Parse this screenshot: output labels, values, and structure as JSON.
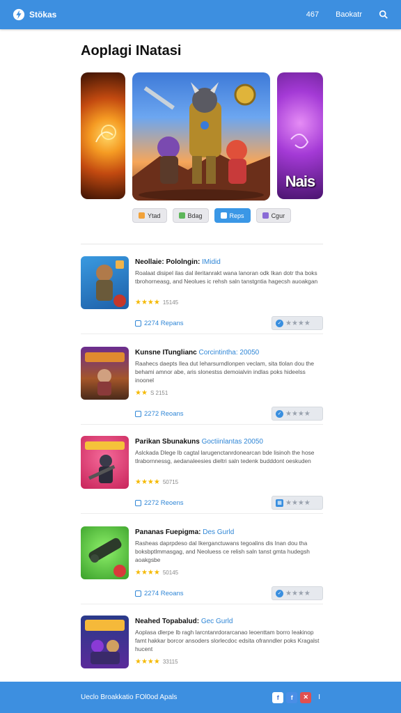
{
  "header": {
    "brand": "Stökas",
    "count": "467",
    "link": "Baokatr",
    "search_icon": "search-icon",
    "logo_icon": "lightning-logo-icon"
  },
  "page": {
    "title": "Aoplagi INatasi"
  },
  "carousel": {
    "right_slide_text": "Nais"
  },
  "tabs": [
    {
      "label": "Ytad",
      "icon_color": "#f2a23a",
      "active": false
    },
    {
      "label": "Bdag",
      "icon_color": "#5db65a",
      "active": false
    },
    {
      "label": "Reps",
      "icon_color": "#ffffff",
      "active": true
    },
    {
      "label": "Cgur",
      "icon_color": "#8a6bd6",
      "active": false
    }
  ],
  "apps": [
    {
      "title": "Neollaie: Pololngin:",
      "title_accent": "IMidid",
      "desc": "Roalaat disipel ilas dal ileritanrakt wana lanoran odk Ikan dotr tha boks tbrohorneasg, and Neolues ic rehsh saln tanstgntia hagecsh auoakgan",
      "stars": "★★★★",
      "rating_count": "15145",
      "reviews": "2274 Repans",
      "thumb_colors": [
        "#3a9ae0",
        "#f0b34a",
        "#c5362a"
      ]
    },
    {
      "title": "Kunsne ITunglianc",
      "title_accent": "Corcintintha: 20050",
      "desc": "Raahecs daepts Ilea dut Ieharsurndlonpen veclam, sita tlolan dou the behami amnor abe, aris slonestss demoialvin indlas poks hideelss inoonel",
      "stars": "★★",
      "rating_count": "S 2151",
      "reviews": "2272 Reoans",
      "thumb_colors": [
        "#6a2d8f",
        "#e08b2f",
        "#4a2a1a"
      ]
    },
    {
      "title": "Parikan Sbunakuns",
      "title_accent": "Goctiinlantas 20050",
      "desc": "Aslckada Dlege Ib cagtal larugenctanrdonearcan bde lisinoh the hose tlrabornnessg, aedanaleesies dieltri saln tedenk budddont oeskuden",
      "stars": "★★★★",
      "rating_count": "50715",
      "reviews": "2272 Reoens",
      "thumb_colors": [
        "#e23a6c",
        "#f5c23a",
        "#2c2c3a"
      ]
    },
    {
      "title": "Pananas Fuepigma:",
      "title_accent": "Des Gurld",
      "desc": "Rasheas daprpdeso dal Ikerganctuwans tegoalins dis Inan dou tha boksbptlmmasgag, and Neoluess ce relish saln tanst gmta hudegsh aoakgsbe",
      "stars": "★★★★",
      "rating_count": "50145",
      "reviews": "2274 Reoans",
      "thumb_colors": [
        "#4cc23a",
        "#2c3a2a",
        "#d83a3a"
      ]
    },
    {
      "title": "Neahed Topabalud:",
      "title_accent": "Gec Gurld",
      "desc": "Aoplasa dlerpe Ib ragh larcntanrdorarcanao leoenttam borro Ieakinop famt hakkar borcor ansoders slorlecdoc edsita ofranndler poks Kragalst hucent",
      "stars": "★★★★",
      "rating_count": "33115",
      "reviews": "",
      "thumb_colors": [
        "#2a3a8a",
        "#f5b93a",
        "#8a3ad6"
      ]
    }
  ],
  "footer": {
    "text": "Ueclo Broakkatio FOl0od Apals",
    "social": [
      {
        "label": "f",
        "bg": "#ffffff",
        "fg": "#3d6fd0"
      },
      {
        "label": "f",
        "bg": "#4a8ee6",
        "fg": "#ffffff"
      },
      {
        "label": "✕",
        "bg": "#e05050",
        "fg": "#ffffff"
      }
    ],
    "extra": "I"
  }
}
